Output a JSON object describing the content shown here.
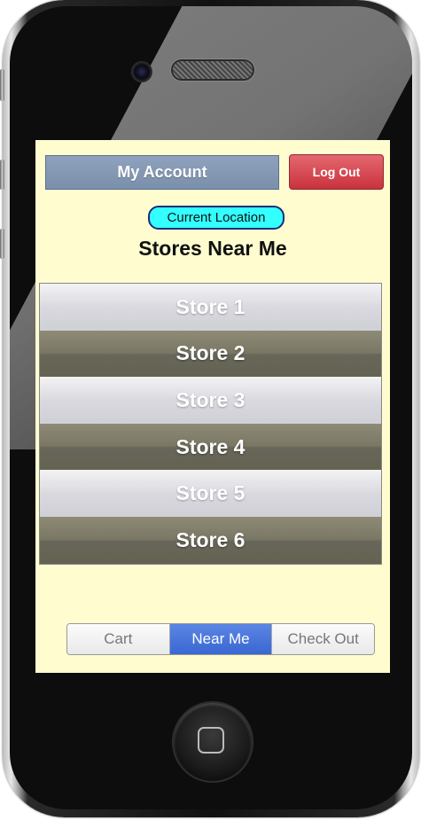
{
  "header": {
    "account_label": "My Account",
    "logout_label": "Log Out"
  },
  "location": {
    "button_label": "Current Location"
  },
  "page": {
    "title": "Stores Near Me"
  },
  "stores": [
    {
      "label": "Store 1"
    },
    {
      "label": "Store 2"
    },
    {
      "label": "Store 3"
    },
    {
      "label": "Store 4"
    },
    {
      "label": "Store 5"
    },
    {
      "label": "Store 6"
    }
  ],
  "tabs": [
    {
      "label": "Cart"
    },
    {
      "label": "Near Me"
    },
    {
      "label": "Check Out"
    }
  ],
  "active_tab": "Near Me",
  "colors": {
    "screen_background": "#fffdd0",
    "account_button": "#7a8fab",
    "logout_button": "#c9323d",
    "location_button": "#33ffff",
    "active_tab": "#3a67d2"
  },
  "icons": {
    "home_button": "home-square-icon",
    "camera": "camera-icon",
    "speaker": "speaker-icon"
  }
}
